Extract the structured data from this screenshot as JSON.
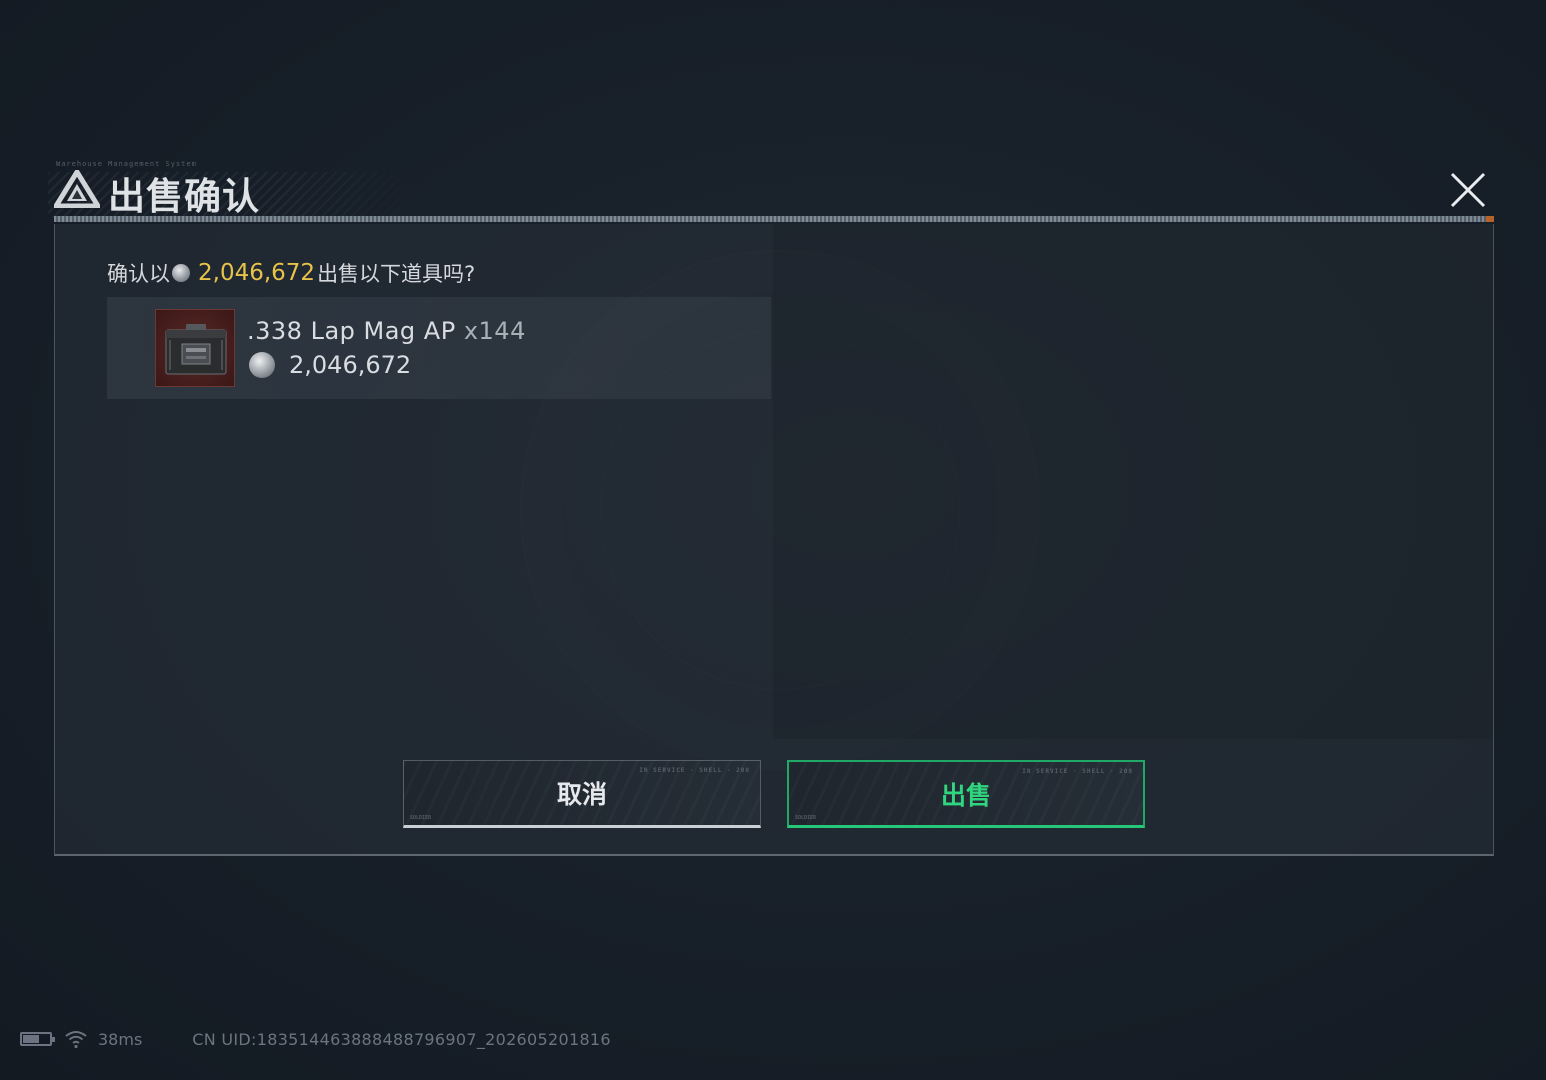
{
  "dialog": {
    "title": "出售确认",
    "header_microtext": "Warehouse Management System",
    "confirm_prefix": "确认以",
    "confirm_amount": "2,046,672",
    "confirm_suffix": "出售以下道具吗?",
    "item": {
      "name": ".338 Lap Mag AP",
      "quantity": "x144",
      "price": "2,046,672",
      "icon": "ammo-box-icon"
    },
    "cancel_label": "取消",
    "sell_label": "出售",
    "button_microtext": "IN SERVICE · SHELL · 208",
    "button_corner_text": "SOLDIER"
  },
  "status_bar": {
    "ping": "38ms",
    "uid": "CN UID:18351446388848879690​7_202605201816"
  },
  "colors": {
    "gold": "#e8c34a",
    "green": "#2fd67f",
    "accent_orange": "#c86a2a"
  }
}
